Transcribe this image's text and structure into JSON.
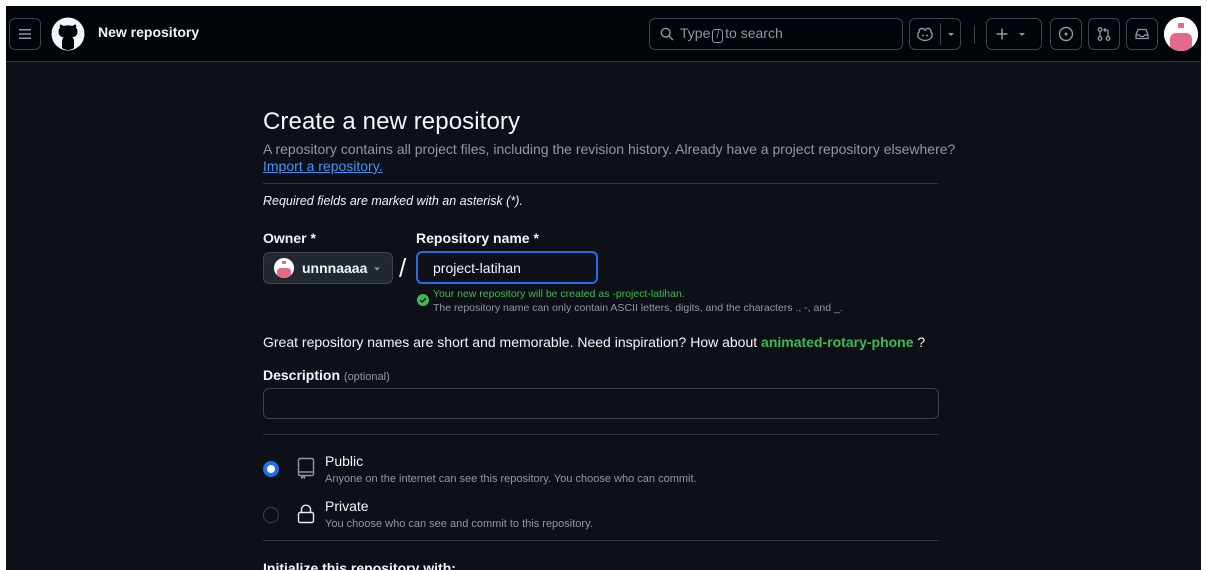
{
  "header": {
    "page_title": "New repository",
    "search": {
      "prefix": "Type",
      "key": "/",
      "suffix": "to search"
    }
  },
  "main": {
    "heading": "Create a new repository",
    "subtitle": "A repository contains all project files, including the revision history. Already have a project repository elsewhere?",
    "import_link": "Import a repository.",
    "required_note": "Required fields are marked with an asterisk (*).",
    "owner": {
      "label": "Owner *",
      "value": "unnnaaaa"
    },
    "separator": "/",
    "repo_name": {
      "label": "Repository name *",
      "value": "project-latihan",
      "success": "Your new repository will be created as -project-latihan.",
      "rules": "The repository name can only contain ASCII letters, digits, and the characters ., -, and _."
    },
    "inspiration": {
      "text": "Great repository names are short and memorable. Need inspiration? How about",
      "suggestion": "animated-rotary-phone",
      "end": "?"
    },
    "description": {
      "label": "Description",
      "optional": "(optional)",
      "value": ""
    },
    "visibility": {
      "selected": "public",
      "options": [
        {
          "title": "Public",
          "desc": "Anyone on the internet can see this repository. You choose who can commit."
        },
        {
          "title": "Private",
          "desc": "You choose who can see and commit to this repository."
        }
      ]
    },
    "init_heading": "Initialize this repository with:"
  },
  "colors": {
    "background": "#0d1117",
    "header": "#010409",
    "accent": "#1f6feb",
    "link": "#4493f8",
    "success": "#3fb950",
    "muted": "#9198a1",
    "border": "#3d444d"
  },
  "icons": [
    "menu-icon",
    "github-logo-icon",
    "search-icon",
    "copilot-icon",
    "plus-icon",
    "issues-icon",
    "pull-request-icon",
    "inbox-icon",
    "check-circle-icon",
    "repo-icon",
    "lock-icon"
  ]
}
